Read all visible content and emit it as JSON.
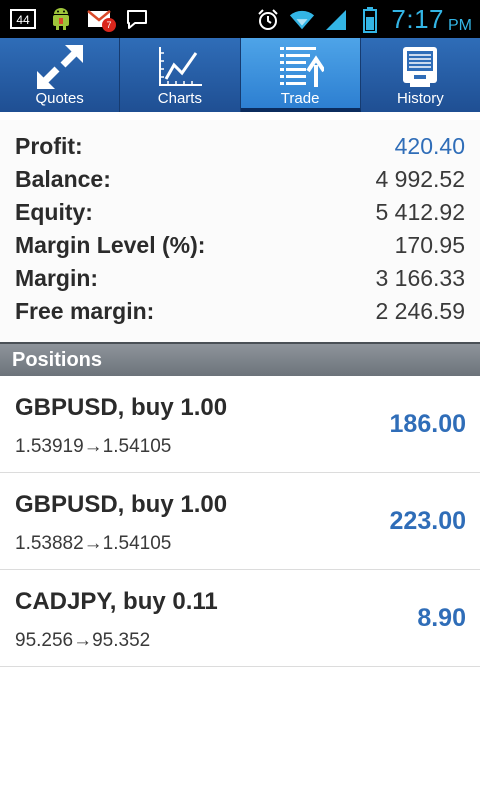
{
  "statusbar": {
    "time": "7:17",
    "ampm": "PM",
    "notification_badge": "7",
    "icons": [
      "notification-44-icon",
      "android-icon",
      "gmail-icon",
      "chat-bubble-icon",
      "alarm-icon",
      "wifi-icon",
      "signal-icon",
      "battery-icon"
    ]
  },
  "tabs": [
    {
      "label": "Quotes",
      "icon": "quotes-arrows-icon",
      "active": false
    },
    {
      "label": "Charts",
      "icon": "charts-line-icon",
      "active": false
    },
    {
      "label": "Trade",
      "icon": "trade-list-icon",
      "active": true
    },
    {
      "label": "History",
      "icon": "history-icon",
      "active": false
    }
  ],
  "summary": {
    "profit_label": "Profit:",
    "profit_value": "420.40",
    "balance_label": "Balance:",
    "balance_value": "4 992.52",
    "equity_label": "Equity:",
    "equity_value": "5 412.92",
    "margin_level_label": "Margin Level (%):",
    "margin_level_value": "170.95",
    "margin_label": "Margin:",
    "margin_value": "3 166.33",
    "free_margin_label": "Free margin:",
    "free_margin_value": "2 246.59"
  },
  "positions_header": "Positions",
  "positions": [
    {
      "title": "GBPUSD, buy 1.00",
      "prices": "1.53919→1.54105",
      "profit": "186.00"
    },
    {
      "title": "GBPUSD, buy 1.00",
      "prices": "1.53882→1.54105",
      "profit": "223.00"
    },
    {
      "title": "CADJPY, buy 0.11",
      "prices": "95.256→95.352",
      "profit": "8.90"
    }
  ],
  "colors": {
    "accent_blue": "#2f6db8",
    "status_blue": "#33b5e5",
    "tab_bg": "#1f4f93"
  }
}
